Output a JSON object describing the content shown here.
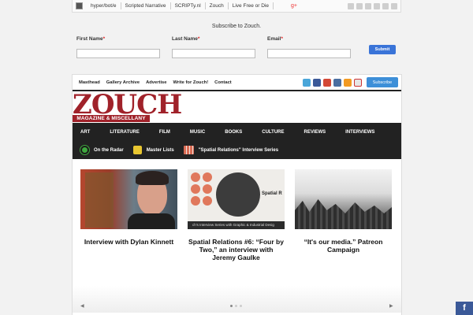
{
  "network_bar": {
    "links": [
      "hyper/bot/e",
      "Scripted Narrative",
      "SCRIPTy.nl",
      "Zouch",
      "Live Free or Die"
    ],
    "plus": "g+"
  },
  "subscribe": {
    "title": "Subscribe to Zouch.",
    "first_name_label": "First Name",
    "last_name_label": "Last Name",
    "email_label": "Email",
    "required_mark": "*",
    "first_name_value": "",
    "last_name_value": "",
    "email_value": "",
    "submit_label": "Submit"
  },
  "top_nav": {
    "items": [
      "Masthead",
      "Gallery Archive",
      "Advertise",
      "Write for Zouch!",
      "Contact"
    ],
    "social_icons": [
      "twitter-icon",
      "facebook-icon",
      "google-plus-icon",
      "instagram-icon",
      "rss-icon",
      "email-icon"
    ],
    "subscribe_label": "Subscribe"
  },
  "brand": {
    "logo_text": "ZOUCH",
    "tagline": "MAGAZINE & MISCELLANY",
    "color": "#a0222a"
  },
  "categories": [
    "ART",
    "LITERATURE",
    "FILM",
    "MUSIC",
    "BOOKS",
    "CULTURE",
    "REVIEWS",
    "INTERVIEWS"
  ],
  "sub_nav": [
    {
      "label": "On the Radar",
      "icon": "radar-icon",
      "color": "#3fa83f"
    },
    {
      "label": "Master Lists",
      "icon": "list-icon",
      "color": "#e8c630"
    },
    {
      "label": "\"Spatial Relations\" Interview Series",
      "icon": "spatial-icon",
      "color": "#d96c55"
    }
  ],
  "cards": [
    {
      "title": "Interview with Dylan Kinnett"
    },
    {
      "title": "Spatial Relations #6: “Four by Two,” an interview with Jeremy Gaulke",
      "thumb_heading": "Spatial R",
      "thumb_strip": "ch's Interview Series with Graphic & Industrial Desig"
    },
    {
      "title": "“It's our media.” Patreon Campaign"
    }
  ],
  "slider": {
    "prev": "◀",
    "next": "▶",
    "pages": 3,
    "active": 0
  },
  "facebook_float": "f"
}
